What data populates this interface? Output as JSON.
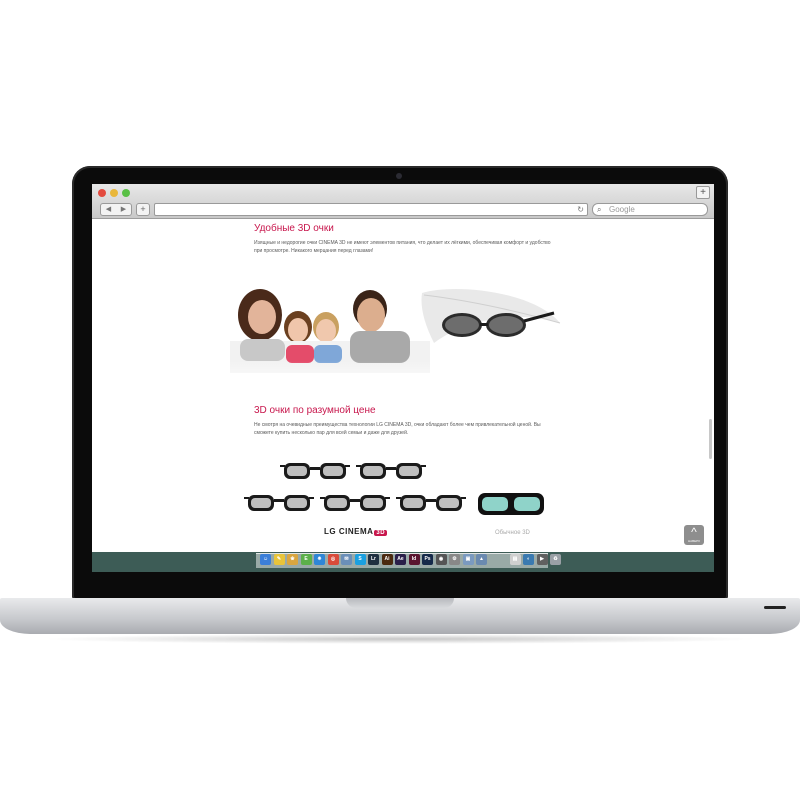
{
  "browser": {
    "search_placeholder": "Google",
    "add_tab": "+",
    "new_tab": "+",
    "reload": "↻",
    "back": "◀",
    "forward": "▶"
  },
  "section1": {
    "title": "Удобные 3D очки",
    "text": "Изящные и недорогие очки CINEMA 3D не имеют элементов питания, что делает их лёгкими, обеспечивая комфорт и удобство при просмотре. Никакого мерцания перед глазами!"
  },
  "section2": {
    "title": "3D очки по разумной цене",
    "text": "Не смотря на очевидные преимущества технологии LG CINEMA 3D, очки обладают более чем привлекательной ценой. Вы сможете купить несколько пар для всей семьи и даже для друзей."
  },
  "labels": {
    "lg_cinema": "LG CINEMA",
    "lg_3d": "3D",
    "ordinary": "Обычное 3D"
  },
  "up_button": {
    "arrow": "^",
    "text": "НАВЕРХ"
  },
  "dock_icons": [
    {
      "name": "finder-icon",
      "glyph": "☺",
      "color": "#3b7fd8"
    },
    {
      "name": "notes-icon",
      "glyph": "✎",
      "color": "#e8c43a"
    },
    {
      "name": "photos-icon",
      "glyph": "❀",
      "color": "#d9a640"
    },
    {
      "name": "evernote-icon",
      "glyph": "E",
      "color": "#5bb04a"
    },
    {
      "name": "safari-icon",
      "glyph": "✵",
      "color": "#2e86d6"
    },
    {
      "name": "chrome-icon",
      "glyph": "◎",
      "color": "#d84b3a"
    },
    {
      "name": "mail-icon",
      "glyph": "✉",
      "color": "#6a8fb8"
    },
    {
      "name": "skype-icon",
      "glyph": "S",
      "color": "#1aa0e0"
    },
    {
      "name": "lightroom-icon",
      "glyph": "Lr",
      "color": "#1f3040"
    },
    {
      "name": "illustrator-icon",
      "glyph": "Ai",
      "color": "#4a2a10"
    },
    {
      "name": "aftereffects-icon",
      "glyph": "Ae",
      "color": "#2a1f4a"
    },
    {
      "name": "indesign-icon",
      "glyph": "Id",
      "color": "#5a1530"
    },
    {
      "name": "photoshop-icon",
      "glyph": "Ps",
      "color": "#152a4a"
    },
    {
      "name": "camera-icon",
      "glyph": "◉",
      "color": "#555555"
    },
    {
      "name": "settings-icon",
      "glyph": "⚙",
      "color": "#888888"
    },
    {
      "name": "preview-icon",
      "glyph": "▣",
      "color": "#7a9ac0"
    },
    {
      "name": "apps-icon",
      "glyph": "▲",
      "color": "#6a8ab0"
    },
    {
      "name": "documents-icon",
      "glyph": "▤",
      "color": "#cfcfcf"
    },
    {
      "name": "globe-icon",
      "glyph": "◐",
      "color": "#3a7ab0"
    },
    {
      "name": "video-icon",
      "glyph": "▶",
      "color": "#606060"
    },
    {
      "name": "trash-icon",
      "glyph": "♻",
      "color": "#9aa0a6"
    }
  ]
}
